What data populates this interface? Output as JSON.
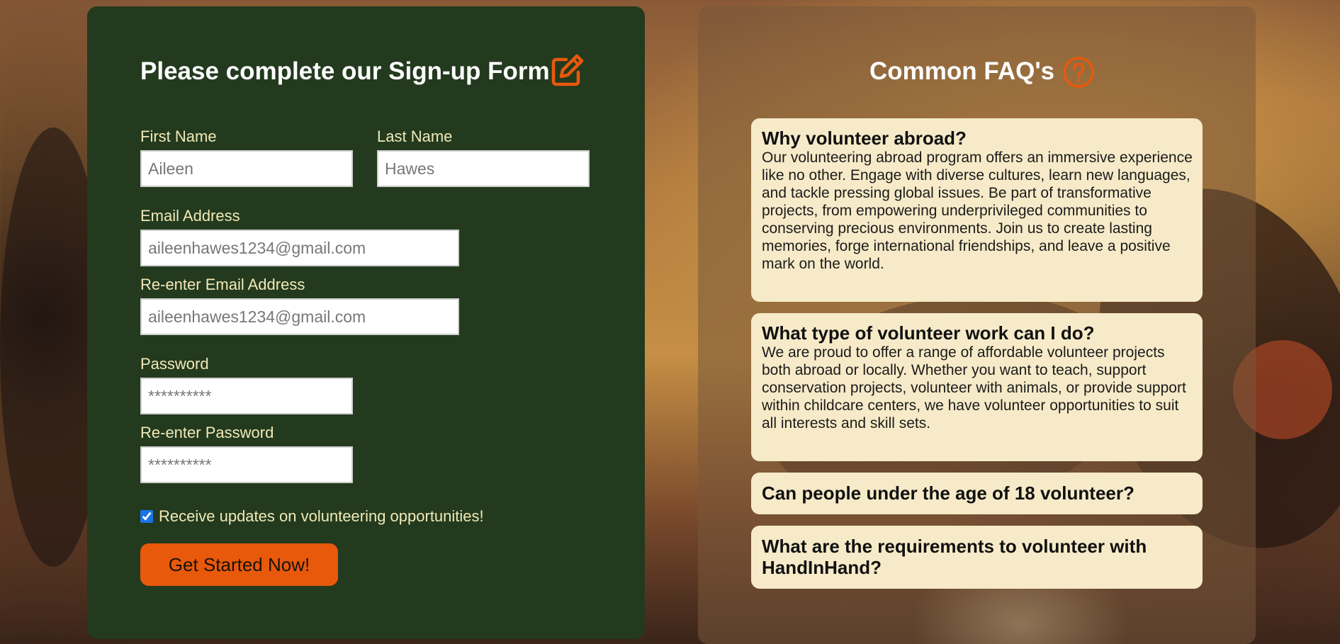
{
  "signup": {
    "title": "Please complete our Sign-up Form",
    "first_name": {
      "label": "First Name",
      "placeholder": "Aileen"
    },
    "last_name": {
      "label": "Last Name",
      "placeholder": "Hawes"
    },
    "email": {
      "label": "Email Address",
      "placeholder": "aileenhawes1234@gmail.com"
    },
    "email_confirm": {
      "label": "Re-enter Email Address",
      "placeholder": "aileenhawes1234@gmail.com"
    },
    "password": {
      "label": "Password",
      "placeholder": "**********"
    },
    "password_confirm": {
      "label": "Re-enter Password",
      "placeholder": "**********"
    },
    "updates_checkbox": {
      "label": "Receive updates on volunteering opportunities!",
      "checked": true
    },
    "submit_label": "Get Started Now!"
  },
  "faq": {
    "title": "Common FAQ's",
    "items": [
      {
        "question": "Why volunteer abroad?",
        "answer": "Our volunteering abroad program offers an immersive experience like no other. Engage with diverse cultures, learn new languages, and tackle pressing global issues. Be part of transformative projects, from empowering underprivileged communities to conserving precious environments. Join us to create lasting memories, forge international friendships, and leave a positive mark on the world."
      },
      {
        "question": "What type of volunteer work can I do?",
        "answer": "We are proud to offer a range of affordable volunteer projects both abroad or locally. Whether you want to teach, support conservation projects, volunteer with animals, or provide support within childcare centers, we have volunteer opportunities to suit all interests and skill sets."
      },
      {
        "question": "Can people under the age of 18 volunteer?",
        "answer": ""
      },
      {
        "question": "What are the requirements to volunteer with HandInHand?",
        "answer": ""
      }
    ]
  },
  "icons": {
    "edit": "edit-icon",
    "help": "question-circle-icon"
  },
  "colors": {
    "form_panel": "#233a1e",
    "accent": "#e8590c",
    "label_text": "#f1e9b8",
    "faq_card": "#f6eac8"
  }
}
